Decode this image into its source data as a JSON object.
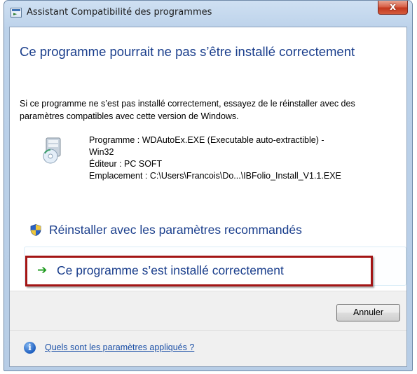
{
  "window": {
    "title": "Assistant Compatibilité des programmes",
    "close_glyph": "x"
  },
  "main": {
    "heading": "Ce programme pourrait ne pas s’être installé correctement",
    "intro": "Si ce programme ne s’est pas installé correctement, essayez de le réinstaller avec des paramètres compatibles avec cette version de Windows.",
    "program_icon": "installer-disc-icon",
    "details": {
      "program_line1": "Programme : WDAutoEx.EXE (Executable auto-extractible) -",
      "program_line2": "Win32",
      "publisher": "Éditeur : PC SOFT",
      "location": "Emplacement : C:\\Users\\Francois\\Do...\\IBFolio_Install_V1.1.EXE"
    }
  },
  "options": [
    {
      "icon": "uac-shield-icon",
      "label": "Réinstaller avec les paramètres recommandés"
    },
    {
      "icon": "green-arrow-icon",
      "label": "Ce programme s’est installé correctement",
      "highlight_color": "#a31515"
    }
  ],
  "footer": {
    "cancel_label": "Annuler",
    "help_icon": "info-icon",
    "help_link": "Quels sont les paramètres appliqués ?"
  },
  "colors": {
    "heading_blue": "#1a3e8c",
    "link_blue": "#1a4fa6",
    "highlight_red": "#a31515",
    "arrow_green": "#1e9a1e"
  }
}
